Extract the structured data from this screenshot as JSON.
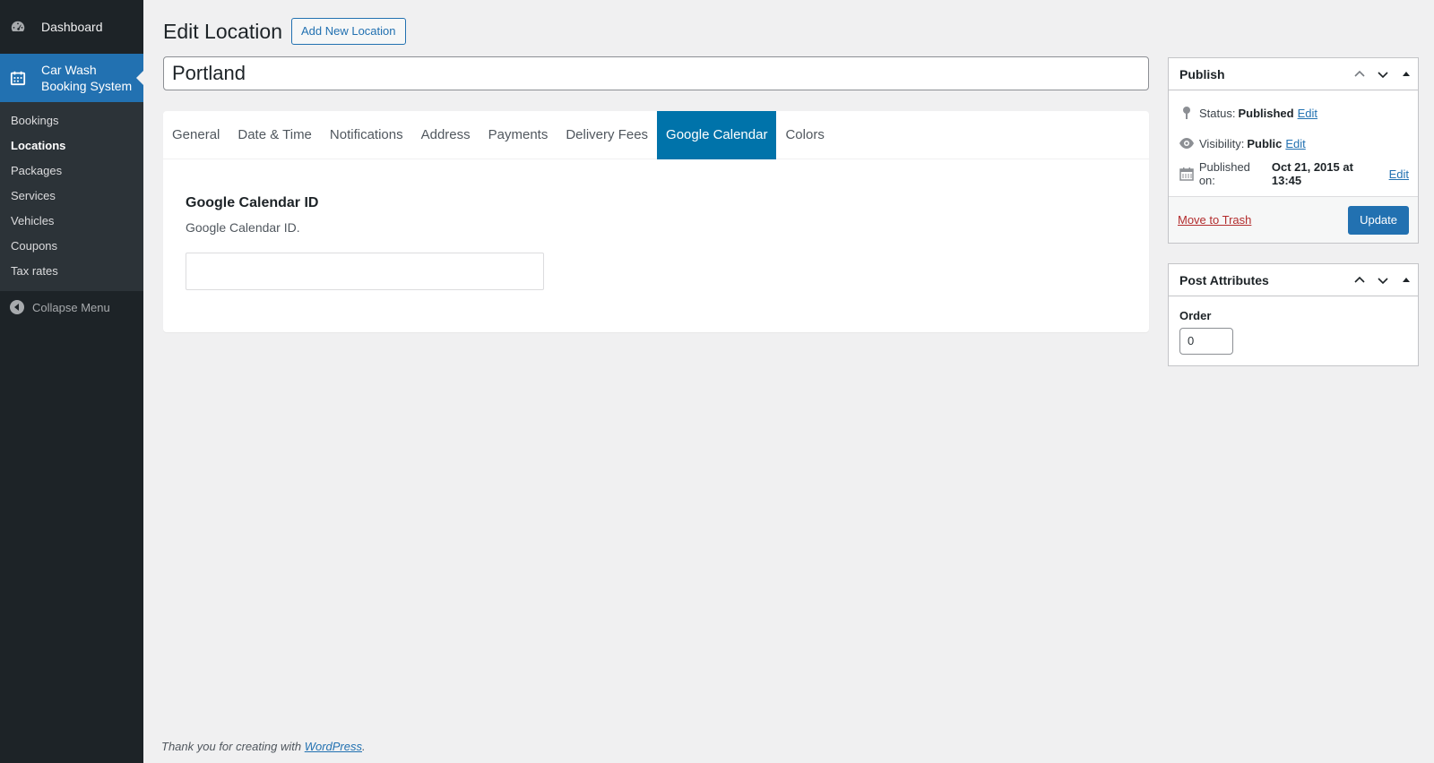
{
  "sidebar": {
    "dashboard": "Dashboard",
    "current_menu": "Car Wash Booking System",
    "current_menu_line1": "Car Wash",
    "current_menu_line2": "Booking System",
    "submenu": [
      "Bookings",
      "Locations",
      "Packages",
      "Services",
      "Vehicles",
      "Coupons",
      "Tax rates"
    ],
    "current_submenu": "Locations",
    "collapse": "Collapse Menu"
  },
  "header": {
    "title": "Edit Location",
    "add_new": "Add New Location"
  },
  "post_title": "Portland",
  "tabs": [
    {
      "label": "General",
      "active": false
    },
    {
      "label": "Date & Time",
      "active": false
    },
    {
      "label": "Notifications",
      "active": false
    },
    {
      "label": "Address",
      "active": false
    },
    {
      "label": "Payments",
      "active": false
    },
    {
      "label": "Delivery Fees",
      "active": false
    },
    {
      "label": "Google Calendar",
      "active": true
    },
    {
      "label": "Colors",
      "active": false
    }
  ],
  "field": {
    "label": "Google Calendar ID",
    "description": "Google Calendar ID.",
    "value": ""
  },
  "publish": {
    "title": "Publish",
    "status_label": "Status:",
    "status_value": "Published",
    "visibility_label": "Visibility:",
    "visibility_value": "Public",
    "published_label": "Published on:",
    "published_value": "Oct 21, 2015 at 13:45",
    "edit": "Edit",
    "trash": "Move to Trash",
    "update": "Update"
  },
  "attributes": {
    "title": "Post Attributes",
    "order_label": "Order",
    "order_value": "0"
  },
  "footer": {
    "text": "Thank you for creating with",
    "link": "WordPress",
    "period": "."
  },
  "colors": {
    "sidebar_bg": "#1d2327",
    "submenu_bg": "#2c3338",
    "accent": "#2271b1",
    "active_tab": "#0073aa",
    "trash": "#b32d2e"
  },
  "icons": {
    "dashboard": "dashboard-icon",
    "calendar": "calendar-icon",
    "collapse": "collapse-arrow-icon",
    "status": "pin-icon",
    "visibility": "eye-icon",
    "published": "calendar-icon"
  }
}
